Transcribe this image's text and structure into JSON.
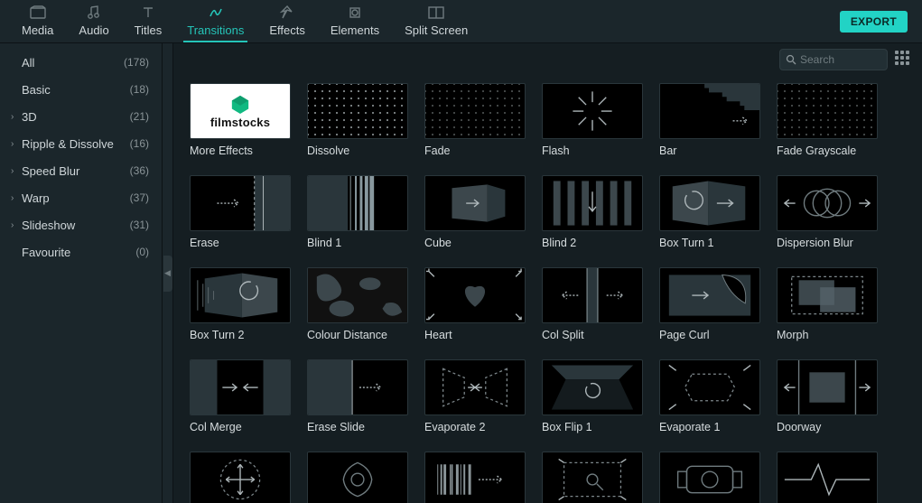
{
  "top_tabs": [
    {
      "id": "media",
      "label": "Media"
    },
    {
      "id": "audio",
      "label": "Audio"
    },
    {
      "id": "titles",
      "label": "Titles"
    },
    {
      "id": "transitions",
      "label": "Transitions",
      "active": true
    },
    {
      "id": "effects",
      "label": "Effects"
    },
    {
      "id": "elements",
      "label": "Elements"
    },
    {
      "id": "splitscreen",
      "label": "Split Screen"
    }
  ],
  "export_label": "EXPORT",
  "search": {
    "placeholder": "Search",
    "value": ""
  },
  "sidebar": [
    {
      "label": "All",
      "count": "(178)",
      "expandable": false
    },
    {
      "label": "Basic",
      "count": "(18)",
      "expandable": false
    },
    {
      "label": "3D",
      "count": "(21)",
      "expandable": true
    },
    {
      "label": "Ripple & Dissolve",
      "count": "(16)",
      "expandable": true
    },
    {
      "label": "Speed Blur",
      "count": "(36)",
      "expandable": true
    },
    {
      "label": "Warp",
      "count": "(37)",
      "expandable": true
    },
    {
      "label": "Slideshow",
      "count": "(31)",
      "expandable": true
    },
    {
      "label": "Favourite",
      "count": "(0)",
      "expandable": false
    }
  ],
  "items": [
    {
      "label": "More Effects",
      "art": "filmstocks"
    },
    {
      "label": "Dissolve",
      "art": "dots"
    },
    {
      "label": "Fade",
      "art": "dots-faint"
    },
    {
      "label": "Flash",
      "art": "flash"
    },
    {
      "label": "Bar",
      "art": "bar"
    },
    {
      "label": "Fade Grayscale",
      "art": "dots-faint"
    },
    {
      "label": "Erase",
      "art": "erase"
    },
    {
      "label": "Blind 1",
      "art": "blind1"
    },
    {
      "label": "Cube",
      "art": "cube"
    },
    {
      "label": "Blind 2",
      "art": "blind2"
    },
    {
      "label": "Box Turn 1",
      "art": "boxturn1"
    },
    {
      "label": "Dispersion Blur",
      "art": "dispersion"
    },
    {
      "label": "Box Turn 2",
      "art": "boxturn2"
    },
    {
      "label": "Colour Distance",
      "art": "colourdist"
    },
    {
      "label": "Heart",
      "art": "heart"
    },
    {
      "label": "Col Split",
      "art": "colsplit"
    },
    {
      "label": "Page Curl",
      "art": "pagecurl"
    },
    {
      "label": "Morph",
      "art": "morph"
    },
    {
      "label": "Col Merge",
      "art": "colmerge"
    },
    {
      "label": "Erase Slide",
      "art": "eraseslide"
    },
    {
      "label": "Evaporate 2",
      "art": "evap2"
    },
    {
      "label": "Box Flip 1",
      "art": "boxflip1"
    },
    {
      "label": "Evaporate 1",
      "art": "evap1"
    },
    {
      "label": "Doorway",
      "art": "doorway"
    },
    {
      "label": "",
      "art": "cross"
    },
    {
      "label": "",
      "art": "flower"
    },
    {
      "label": "",
      "art": "barcode"
    },
    {
      "label": "",
      "art": "zoomrect"
    },
    {
      "label": "",
      "art": "camera"
    },
    {
      "label": "",
      "art": "pulse"
    }
  ],
  "filmstocks_text": "filmstocks"
}
